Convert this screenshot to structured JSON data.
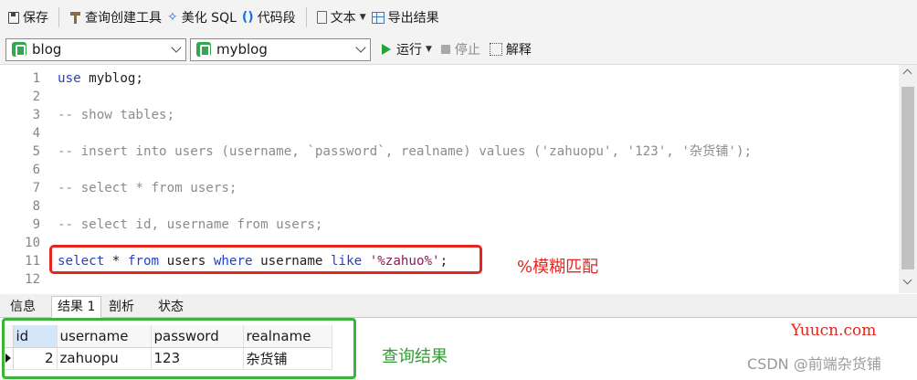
{
  "toolbar": {
    "save": "保存",
    "query_builder": "查询创建工具",
    "beautify": "美化 SQL",
    "snippet": "代码段",
    "text": "文本",
    "export": "导出结果"
  },
  "connection": {
    "selected": "blog"
  },
  "database": {
    "selected": "myblog"
  },
  "actions": {
    "run": "运行",
    "stop": "停止",
    "explain": "解释"
  },
  "editor": {
    "line_numbers": [
      "1",
      "2",
      "3",
      "4",
      "5",
      "6",
      "7",
      "8",
      "9",
      "10",
      "11",
      "12"
    ],
    "lines": {
      "l1": {
        "kw": "use",
        "rest": " myblog;"
      },
      "l3": "-- show tables;",
      "l5": "-- insert into users (username, `password`, realname) values ('zahuopu', '123', '杂货铺');",
      "l7": "-- select * from users;",
      "l9": "-- select id, username from users;",
      "l11": {
        "t1": "select",
        "t2": " * ",
        "t3": "from",
        "t4": " users ",
        "t5": "where",
        "t6": " username ",
        "t7": "like",
        "t8": " ",
        "t9": "'%zahuo%'",
        "t10": ";"
      }
    }
  },
  "annotations": {
    "fuzzy_match": "%模糊匹配",
    "query_result": "查询结果"
  },
  "tabs": [
    "信息",
    "结果 1",
    "剖析",
    "状态"
  ],
  "result": {
    "columns": [
      "id",
      "username",
      "password",
      "realname"
    ],
    "rows": [
      [
        "2",
        "zahuopu",
        "123",
        "杂货铺"
      ]
    ]
  },
  "watermarks": {
    "site": "Yuucn.com",
    "author": "CSDN @前端杂货铺"
  },
  "colors": {
    "keyword": "#1f43c7",
    "comment": "#8c8c8c",
    "string": "#8b1a55",
    "highlight_red": "#e5261f",
    "highlight_green": "#3cb43c",
    "run_green": "#21a53a"
  },
  "icons": [
    "save-icon",
    "query-builder-icon",
    "beautify-wand-icon",
    "braces-icon",
    "document-icon",
    "export-icon",
    "database-icon",
    "play-icon",
    "stop-icon",
    "explain-icon"
  ]
}
